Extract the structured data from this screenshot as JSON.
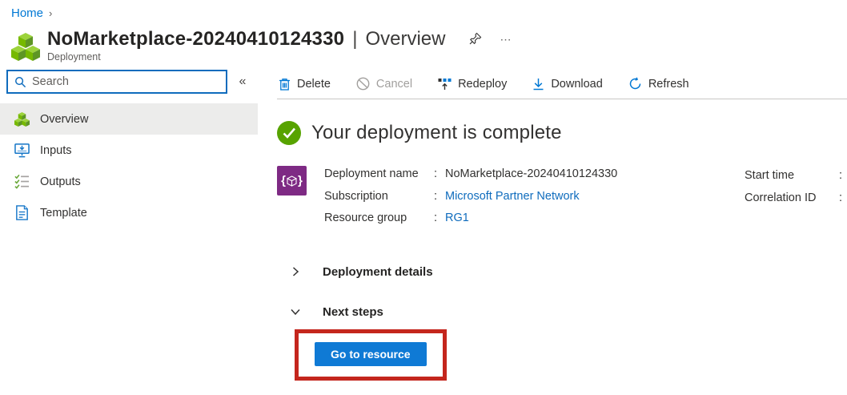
{
  "breadcrumb": {
    "home": "Home",
    "separator": "›"
  },
  "header": {
    "title": "NoMarketplace-20240410124330",
    "separator": "|",
    "active_tab": "Overview",
    "resource_type": "Deployment"
  },
  "sidebar": {
    "search_placeholder": "Search",
    "collapse_icon": "«",
    "items": [
      {
        "label": "Overview",
        "icon": "cubes-icon",
        "selected": true
      },
      {
        "label": "Inputs",
        "icon": "inputs-icon",
        "selected": false
      },
      {
        "label": "Outputs",
        "icon": "outputs-icon",
        "selected": false
      },
      {
        "label": "Template",
        "icon": "template-icon",
        "selected": false
      }
    ]
  },
  "toolbar": {
    "delete_label": "Delete",
    "cancel_label": "Cancel",
    "redeploy_label": "Redeploy",
    "download_label": "Download",
    "refresh_label": "Refresh"
  },
  "main": {
    "status_message": "Your deployment is complete",
    "fields": [
      {
        "label": "Deployment name",
        "colon": ":",
        "value": "NoMarketplace-20240410124330",
        "is_link": false
      },
      {
        "label": "Subscription",
        "colon": ":",
        "value": "Microsoft Partner Network",
        "is_link": true
      },
      {
        "label": "Resource group",
        "colon": ":",
        "value": "RG1",
        "is_link": true
      }
    ],
    "right_fields": [
      {
        "label": "Start time",
        "colon": ":"
      },
      {
        "label": "Correlation ID",
        "colon": ":"
      }
    ],
    "sections": [
      {
        "label": "Deployment details"
      },
      {
        "label": "Next steps"
      }
    ],
    "go_to_resource_label": "Go to resource"
  },
  "colors": {
    "accent_blue": "#0078d4",
    "link_blue": "#0f6cbd",
    "success_green": "#57a300",
    "deployment_purple": "#7e2a84",
    "highlight_red": "#c4261d",
    "selected_row": "#ececeb"
  }
}
